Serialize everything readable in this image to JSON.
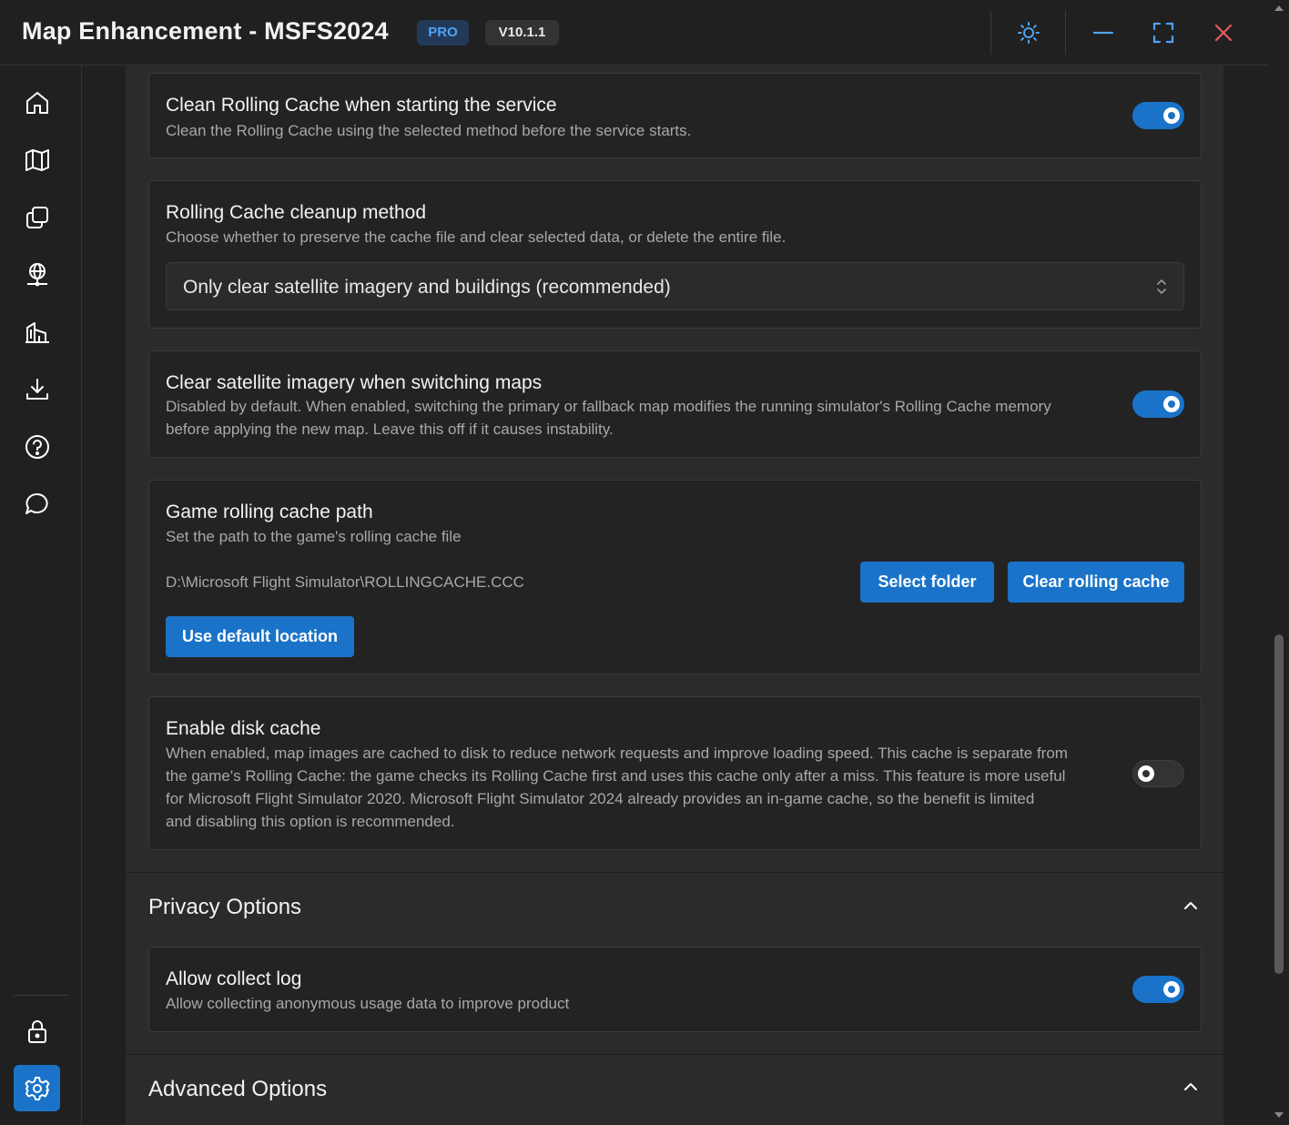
{
  "app": {
    "title": "Map Enhancement - MSFS2024",
    "edition_badge": "PRO",
    "version_badge": "V10.1.1"
  },
  "titlebar_icons": [
    "theme-sun-icon",
    "minimize-icon",
    "fullscreen-icon",
    "close-icon"
  ],
  "sidebar": {
    "items": [
      {
        "icon": "home-icon"
      },
      {
        "icon": "map-icon"
      },
      {
        "icon": "layers-icon"
      },
      {
        "icon": "globe-network-icon"
      },
      {
        "icon": "buildings-icon"
      },
      {
        "icon": "download-icon"
      },
      {
        "icon": "help-icon"
      },
      {
        "icon": "chat-icon"
      }
    ],
    "bottom_items": [
      {
        "icon": "lock-icon"
      },
      {
        "icon": "settings-icon",
        "active": true
      }
    ]
  },
  "settings": {
    "clean_on_start": {
      "title": "Clean Rolling Cache when starting the service",
      "description": "Clean the Rolling Cache using the selected method before the service starts.",
      "enabled": true
    },
    "cleanup_method": {
      "title": "Rolling Cache cleanup method",
      "description": "Choose whether to preserve the cache file and clear selected data, or delete the entire file.",
      "selected": "Only clear satellite imagery and buildings (recommended)"
    },
    "clear_on_switch": {
      "title": "Clear satellite imagery when switching maps",
      "description_line1": "Disabled by default. When enabled, switching the primary or fallback map modifies the running simulator's Rolling Cache memory",
      "description_line2": "before applying the new map. Leave this off if it causes instability.",
      "enabled": true
    },
    "cache_path": {
      "title": "Game rolling cache path",
      "description": "Set the path to the game's rolling cache file",
      "path": "D:\\Microsoft Flight Simulator\\ROLLINGCACHE.CCC",
      "select_folder_label": "Select folder",
      "clear_cache_label": "Clear rolling cache",
      "default_location_label": "Use default location"
    },
    "disk_cache": {
      "title": "Enable disk cache",
      "description_line1": "When enabled, map images are cached to disk to reduce network requests and improve loading speed. This cache is separate from",
      "description_line2": "the game's Rolling Cache: the game checks its Rolling Cache first and uses this cache only after a miss. This feature is more useful",
      "description_line3": "for Microsoft Flight Simulator 2020. Microsoft Flight Simulator 2024 already provides an in-game cache, so the benefit is limited",
      "description_line4": "and disabling this option is recommended.",
      "enabled": false
    }
  },
  "privacy": {
    "section_title": "Privacy Options",
    "collect_log": {
      "title": "Allow collect log",
      "description": "Allow collecting anonymous usage data to improve product",
      "enabled": true
    }
  },
  "advanced": {
    "section_title": "Advanced Options"
  },
  "colors": {
    "accent": "#1a73c8",
    "background": "#202020",
    "card": "#232323",
    "close_icon": "#e85c5c"
  }
}
